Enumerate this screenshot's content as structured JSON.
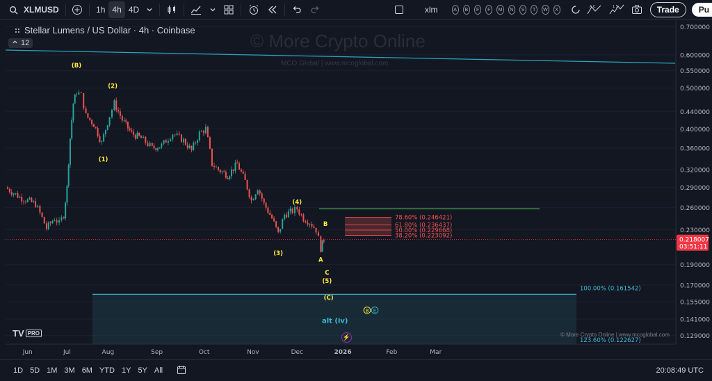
{
  "toolbar": {
    "symbol": "XLMUSD",
    "intervals": [
      "1h",
      "4h",
      "4D"
    ],
    "active_interval": "4h",
    "search_text": "xlm",
    "letters": [
      "A",
      "B",
      "F",
      "F",
      "M",
      "N",
      "S",
      "T",
      "W",
      "X"
    ],
    "trade_label": "Trade",
    "publish_label": "Pu",
    "icons": [
      "search-icon",
      "add-symbol-icon",
      "chevron-down-icon",
      "candles-icon",
      "indicators-icon",
      "layouts-icon",
      "alert-icon",
      "replay-icon",
      "undo-icon",
      "redo-icon",
      "checkbox-icon",
      "camera-icon"
    ]
  },
  "legend": {
    "title": "Stellar Lumens / US Dollar · 4h · Coinbase",
    "badge": "12"
  },
  "watermark": {
    "main": "© More Crypto Online",
    "sub": "MCO Global  |  www.mcoglobal.com"
  },
  "footnote": "© More Crypto Online  |  www.mcoglobal.com",
  "brand": "TV",
  "brand_pro": "PRO",
  "bottom": {
    "ranges": [
      "1D",
      "5D",
      "1M",
      "3M",
      "6M",
      "YTD",
      "1Y",
      "5Y",
      "All"
    ],
    "clock": "20:08:49 UTC"
  },
  "colors": {
    "background": "#131722",
    "up": "#26a69a",
    "down": "#ef5350",
    "wave_label": "#ffeb3b",
    "trendline": "#2aa5c0",
    "target_box": "#1e3a47",
    "resistance": "#4caf50",
    "price_tag": "#f23645"
  },
  "chart_data": {
    "type": "candlestick",
    "x_ticks": [
      "Jun",
      "Jul",
      "Aug",
      "Sep",
      "Oct",
      "Nov",
      "Dec",
      "2026",
      "Feb",
      "Mar"
    ],
    "y_ticks": [
      0.7,
      0.6,
      0.55,
      0.5,
      0.44,
      0.4,
      0.36,
      0.32,
      0.29,
      0.26,
      0.23,
      0.19,
      0.17,
      0.155,
      0.141,
      0.129
    ],
    "y_range": [
      0.122,
      0.72
    ],
    "y_scale": "log",
    "close_path": [
      {
        "x": "Jun 1",
        "y": 0.29
      },
      {
        "x": "Jun 10",
        "y": 0.275
      },
      {
        "x": "Jun 20",
        "y": 0.265
      },
      {
        "x": "Jun 27",
        "y": 0.232
      },
      {
        "x": "Jul 2",
        "y": 0.245
      },
      {
        "x": "Jul 5",
        "y": 0.238
      },
      {
        "x": "Jul 8",
        "y": 0.25
      },
      {
        "x": "Jul 10",
        "y": 0.29
      },
      {
        "x": "Jul 12",
        "y": 0.38
      },
      {
        "x": "Jul 14",
        "y": 0.46
      },
      {
        "x": "Jul 16",
        "y": 0.49
      },
      {
        "x": "Jul 19",
        "y": 0.48
      },
      {
        "x": "Jul 22",
        "y": 0.43
      },
      {
        "x": "Jul 27",
        "y": 0.41
      },
      {
        "x": "Aug 1",
        "y": 0.37
      },
      {
        "x": "Aug 6",
        "y": 0.43
      },
      {
        "x": "Aug 9",
        "y": 0.46
      },
      {
        "x": "Aug 14",
        "y": 0.42
      },
      {
        "x": "Aug 20",
        "y": 0.39
      },
      {
        "x": "Aug 26",
        "y": 0.38
      },
      {
        "x": "Sep 2",
        "y": 0.36
      },
      {
        "x": "Sep 8",
        "y": 0.365
      },
      {
        "x": "Sep 15",
        "y": 0.39
      },
      {
        "x": "Sep 22",
        "y": 0.375
      },
      {
        "x": "Sep 27",
        "y": 0.355
      },
      {
        "x": "Oct 2",
        "y": 0.39
      },
      {
        "x": "Oct 6",
        "y": 0.4
      },
      {
        "x": "Oct 10",
        "y": 0.33
      },
      {
        "x": "Oct 14",
        "y": 0.32
      },
      {
        "x": "Oct 20",
        "y": 0.31
      },
      {
        "x": "Oct 26",
        "y": 0.33
      },
      {
        "x": "Oct 31",
        "y": 0.3
      },
      {
        "x": "Nov 4",
        "y": 0.27
      },
      {
        "x": "Nov 8",
        "y": 0.29
      },
      {
        "x": "Nov 12",
        "y": 0.265
      },
      {
        "x": "Nov 17",
        "y": 0.245
      },
      {
        "x": "Nov 21",
        "y": 0.225
      },
      {
        "x": "Nov 25",
        "y": 0.25
      },
      {
        "x": "Nov 30",
        "y": 0.255
      },
      {
        "x": "Dec 3",
        "y": 0.258
      },
      {
        "x": "Dec 7",
        "y": 0.245
      },
      {
        "x": "Dec 11",
        "y": 0.24
      },
      {
        "x": "Dec 15",
        "y": 0.23
      },
      {
        "x": "Dec 18",
        "y": 0.208
      },
      {
        "x": "Dec 20",
        "y": 0.218
      }
    ],
    "last_price": {
      "value": "0.218007",
      "countdown": "03:51:11"
    },
    "wave_labels": [
      {
        "text": "(B)",
        "x": "Jul 16",
        "y": 0.56
      },
      {
        "text": "(2)",
        "x": "Aug 8",
        "y": 0.5
      },
      {
        "text": "(1)",
        "x": "Aug 2",
        "y": 0.335
      },
      {
        "text": "(3)",
        "x": "Nov 21",
        "y": 0.2
      },
      {
        "text": "(4)",
        "x": "Dec 3",
        "y": 0.265
      },
      {
        "text": "A",
        "x": "Dec 18",
        "y": 0.193
      },
      {
        "text": "B",
        "x": "Dec 21",
        "y": 0.235
      },
      {
        "text": "C",
        "x": "Dec 22",
        "y": 0.18
      },
      {
        "text": "(5)",
        "x": "Dec 22",
        "y": 0.172
      },
      {
        "text": "(C)",
        "x": "Dec 23",
        "y": 0.157
      },
      {
        "text": "alt (iv)",
        "x": "Dec 27",
        "y": 0.138
      }
    ],
    "fib_levels": [
      {
        "label": "78.60% (0.246421)",
        "value": 0.246421
      },
      {
        "label": "61.80% (0.236437)",
        "value": 0.236437
      },
      {
        "label": "50.00% (0.229668)",
        "value": 0.229668
      },
      {
        "label": "38.20% (0.223092)",
        "value": 0.223092
      }
    ],
    "target_zone": [
      {
        "label": "100.00% (0.161542)",
        "value": 0.161542
      },
      {
        "label": "123.60% (0.122627)",
        "value": 0.122627
      }
    ],
    "resistance_line": 0.258,
    "trendline": [
      {
        "x": "Jun 1",
        "y": 0.63
      },
      {
        "x": "Mar 15",
        "y": 0.57
      }
    ],
    "markers": [
      "B",
      "E"
    ]
  }
}
